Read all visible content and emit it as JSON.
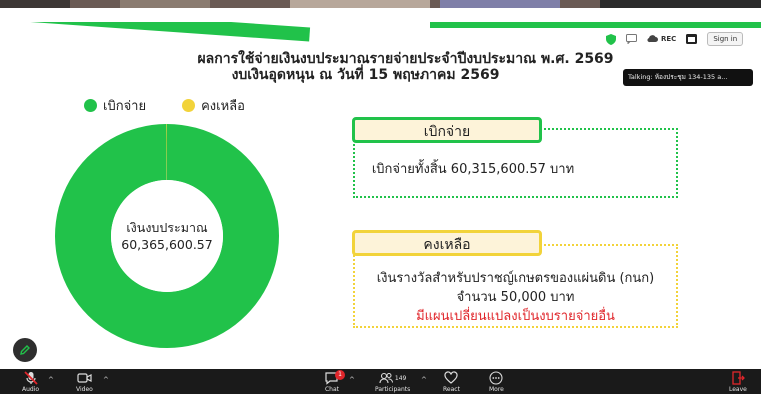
{
  "slide": {
    "title_line1": "ผลการใช้จ่ายเงินงบประมาณรายจ่ายประจำปีงบประมาณ พ.ศ. 2569",
    "title_line2": "งบเงินอุดหนุน ณ วันที่ 15 พฤษภาคม 2569",
    "legend": [
      {
        "label": "เบิกจ่าย",
        "color": "#21c24a"
      },
      {
        "label": "คงเหลือ",
        "color": "#f2d33a"
      }
    ],
    "donut": {
      "center_label": "เงินงบประมาณ",
      "center_value": "60,365,600.57",
      "spent": 60315600.57,
      "remaining": 50000,
      "spent_color": "#21c24a",
      "remaining_color": "#f2d33a"
    },
    "spent_box": {
      "tab_label": "เบิกจ่าย",
      "text": "เบิกจ่ายทั้งสิ้น 60,315,600.57 บาท"
    },
    "remaining_box": {
      "tab_label": "คงเหลือ",
      "line1": "เงินรางวัลสำหรับปราชญ์เกษตรของแผ่นดิน (กนก)",
      "line2": "จำนวน 50,000 บาท",
      "line3": "มีแผนเปลี่ยนแปลงเป็นงบรายจ่ายอื่น",
      "line3_color": "#e0262b"
    }
  },
  "meeting": {
    "rec_label": "REC",
    "signin_label": "Sign in",
    "talking": "Talking: ห้องประชุม 134-135 a..."
  },
  "toolbar": {
    "audio": "Audio",
    "video": "Video",
    "chat": "Chat",
    "chat_badge": "1",
    "participants": "Participants",
    "participants_count": "149",
    "react": "React",
    "more": "More",
    "leave": "Leave"
  }
}
